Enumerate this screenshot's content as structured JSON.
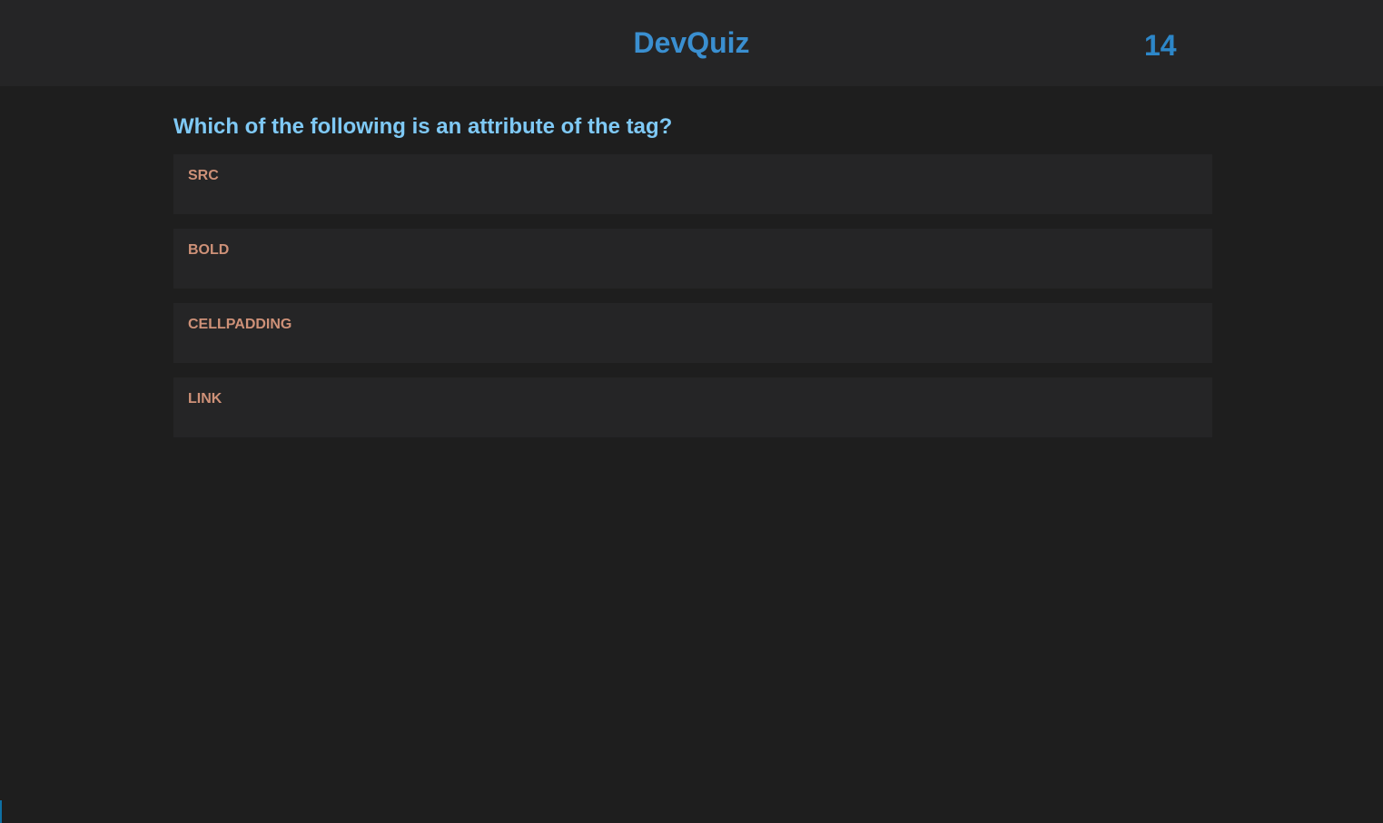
{
  "header": {
    "brand": "DevQuiz",
    "score": "14"
  },
  "quiz": {
    "question": "Which of the following is an attribute of the tag?",
    "options": [
      {
        "label": "SRC"
      },
      {
        "label": "BOLD"
      },
      {
        "label": "CELLPADDING"
      },
      {
        "label": "LINK"
      }
    ]
  },
  "colors": {
    "background": "#1e1e1e",
    "header_background": "#252526",
    "brand": "#3a8fd0",
    "question": "#7fc9f5",
    "option_text": "#ce9178"
  }
}
